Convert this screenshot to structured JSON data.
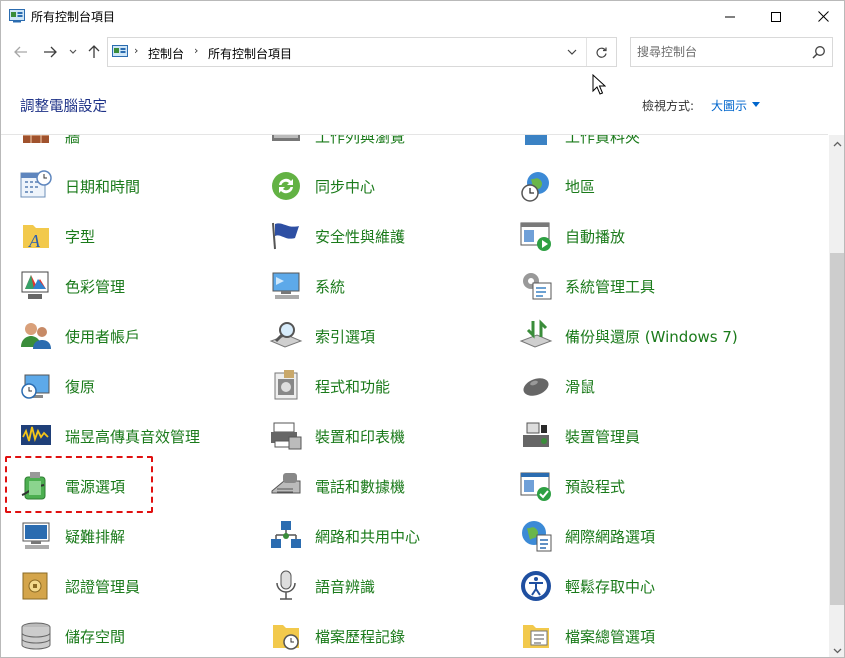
{
  "window": {
    "title": "所有控制台項目"
  },
  "address": {
    "crumbs": [
      "控制台",
      "所有控制台項目"
    ],
    "search_placeholder": "搜尋控制台"
  },
  "header": {
    "title": "調整電腦設定",
    "view_label": "檢視方式:",
    "view_value": "大圖示"
  },
  "items": [
    {
      "label": "牆",
      "icon": "firewall-icon"
    },
    {
      "label": "工作列與瀏覽",
      "icon": "taskbar-icon"
    },
    {
      "label": "工作資料夾",
      "icon": "work-folders-icon"
    },
    {
      "label": "日期和時間",
      "icon": "calendar-clock-icon"
    },
    {
      "label": "同步中心",
      "icon": "sync-icon"
    },
    {
      "label": "地區",
      "icon": "globe-clock-icon"
    },
    {
      "label": "字型",
      "icon": "font-folder-icon"
    },
    {
      "label": "安全性與維護",
      "icon": "flag-icon"
    },
    {
      "label": "自動播放",
      "icon": "autoplay-icon"
    },
    {
      "label": "色彩管理",
      "icon": "color-management-icon"
    },
    {
      "label": "系統",
      "icon": "computer-icon"
    },
    {
      "label": "系統管理工具",
      "icon": "admin-tools-icon"
    },
    {
      "label": "使用者帳戶",
      "icon": "users-icon"
    },
    {
      "label": "索引選項",
      "icon": "indexing-icon"
    },
    {
      "label": "備份與還原 (Windows 7)",
      "icon": "backup-icon"
    },
    {
      "label": "復原",
      "icon": "recovery-icon"
    },
    {
      "label": "程式和功能",
      "icon": "programs-icon"
    },
    {
      "label": "滑鼠",
      "icon": "mouse-icon"
    },
    {
      "label": "瑞昱高傳真音效管理",
      "icon": "audio-manager-icon"
    },
    {
      "label": "裝置和印表機",
      "icon": "printer-icon"
    },
    {
      "label": "裝置管理員",
      "icon": "device-manager-icon"
    },
    {
      "label": "電源選項",
      "icon": "power-battery-icon"
    },
    {
      "label": "電話和數據機",
      "icon": "phone-modem-icon"
    },
    {
      "label": "預設程式",
      "icon": "default-programs-icon"
    },
    {
      "label": "疑難排解",
      "icon": "troubleshoot-icon"
    },
    {
      "label": "網路和共用中心",
      "icon": "network-icon"
    },
    {
      "label": "網際網路選項",
      "icon": "internet-options-icon"
    },
    {
      "label": "認證管理員",
      "icon": "credential-vault-icon"
    },
    {
      "label": "語音辨識",
      "icon": "microphone-icon"
    },
    {
      "label": "輕鬆存取中心",
      "icon": "ease-of-access-icon"
    },
    {
      "label": "儲存空間",
      "icon": "storage-icon"
    },
    {
      "label": "檔案歷程記錄",
      "icon": "file-history-icon"
    },
    {
      "label": "檔案總管選項",
      "icon": "explorer-options-icon"
    }
  ],
  "colors": {
    "link_green": "#1a7a1a",
    "title_blue": "#1e3287",
    "highlight_red": "#e01010"
  }
}
